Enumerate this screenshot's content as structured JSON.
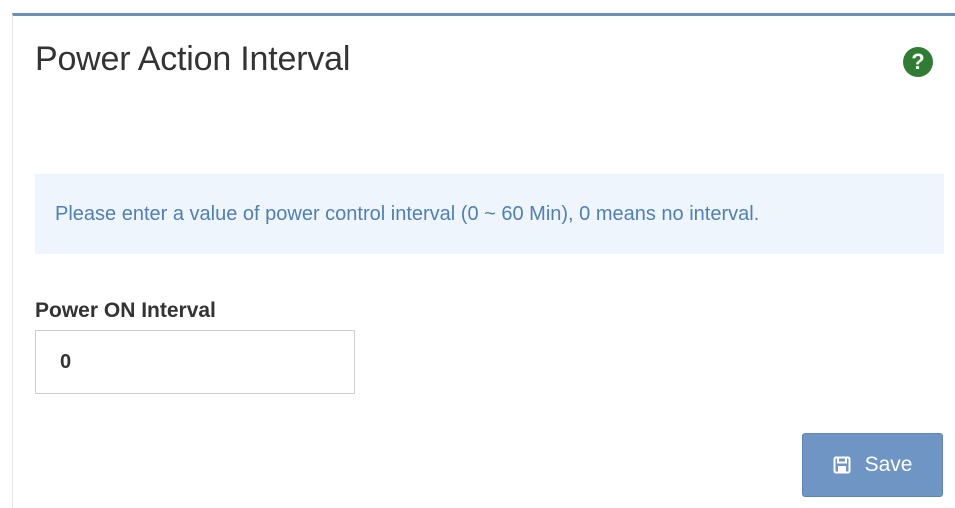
{
  "panel": {
    "title": "Power Action Interval",
    "help_icon": "question-circle-icon",
    "accent_color": "#6d8fb8"
  },
  "info": {
    "text": "Please enter a value of power control interval (0 ~ 60 Min), 0 means no interval."
  },
  "form": {
    "power_on_label": "Power ON Interval",
    "power_on_value": "0"
  },
  "actions": {
    "save_label": "Save",
    "save_icon": "floppy-disk-icon"
  },
  "colors": {
    "help_green": "#2f7d32",
    "info_bg": "#eef5fc",
    "info_text": "#4f7fb6",
    "button_bg": "#6e95c4"
  }
}
